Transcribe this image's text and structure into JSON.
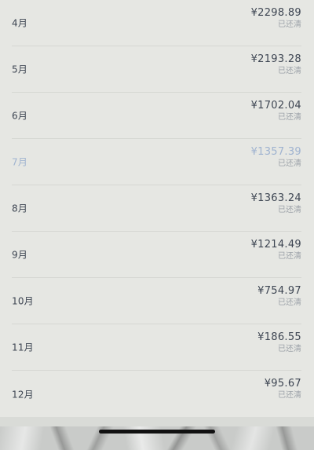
{
  "repayment_schedule": {
    "rows": [
      {
        "month": "4月",
        "amount": "¥2298.89",
        "status": "已还清"
      },
      {
        "month": "5月",
        "amount": "¥2193.28",
        "status": "已还清"
      },
      {
        "month": "6月",
        "amount": "¥1702.04",
        "status": "已还清"
      },
      {
        "month": "7月",
        "amount": "¥1357.39",
        "status": "已还清"
      },
      {
        "month": "8月",
        "amount": "¥1363.24",
        "status": "已还清"
      },
      {
        "month": "9月",
        "amount": "¥1214.49",
        "status": "已还清"
      },
      {
        "month": "10月",
        "amount": "¥754.97",
        "status": "已还清"
      },
      {
        "month": "11月",
        "amount": "¥186.55",
        "status": "已还清"
      },
      {
        "month": "12月",
        "amount": "¥95.67",
        "status": "已还清"
      }
    ],
    "highlight_color": "#9fb3d0",
    "text_color": "#3d4552",
    "status_color": "#9ca2a8"
  }
}
